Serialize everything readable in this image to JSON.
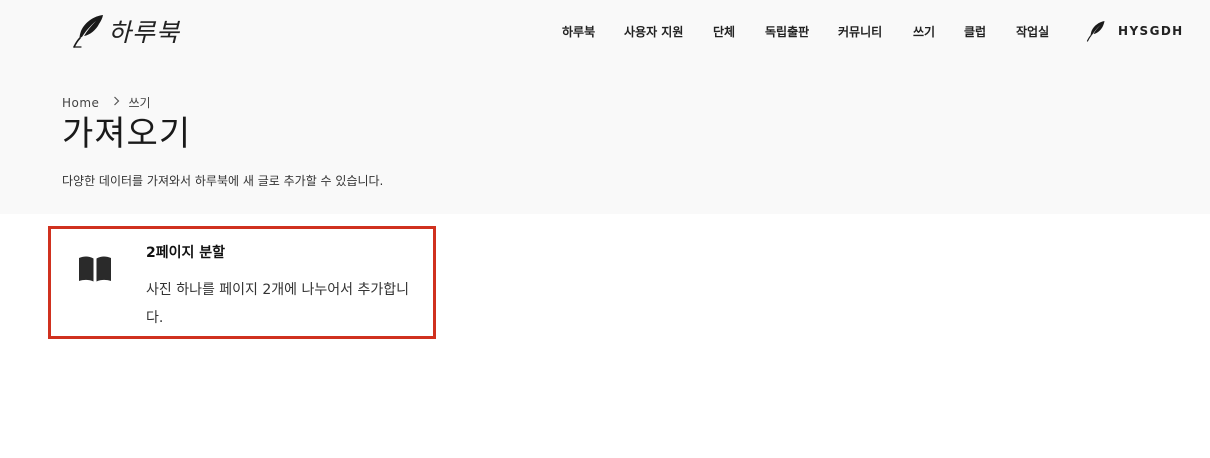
{
  "header": {
    "logo_text": "하루북",
    "logo_icon": "quill-icon",
    "nav": [
      {
        "label": "하루북"
      },
      {
        "label": "사용자 지원"
      },
      {
        "label": "단체"
      },
      {
        "label": "독립출판"
      },
      {
        "label": "커뮤니티"
      },
      {
        "label": "쓰기"
      },
      {
        "label": "클럽"
      },
      {
        "label": "작업실"
      }
    ],
    "user": {
      "icon": "quill-icon",
      "name": "HYSGDH"
    }
  },
  "breadcrumb": {
    "home": "Home",
    "separator_icon": "chevron-right-icon",
    "current": "쓰기"
  },
  "page": {
    "title": "가져오기",
    "description": "다양한 데이터를 가져와서 하루북에 새 글로 추가할 수 있습니다."
  },
  "cards": [
    {
      "icon": "open-book-icon",
      "title": "2페이지 분할",
      "description": "사진 하나를 페이지 2개에 나누어서 추가합니다."
    }
  ],
  "colors": {
    "header_bg": "#f9f9f9",
    "card_border": "#d0311f",
    "text": "#222222"
  }
}
